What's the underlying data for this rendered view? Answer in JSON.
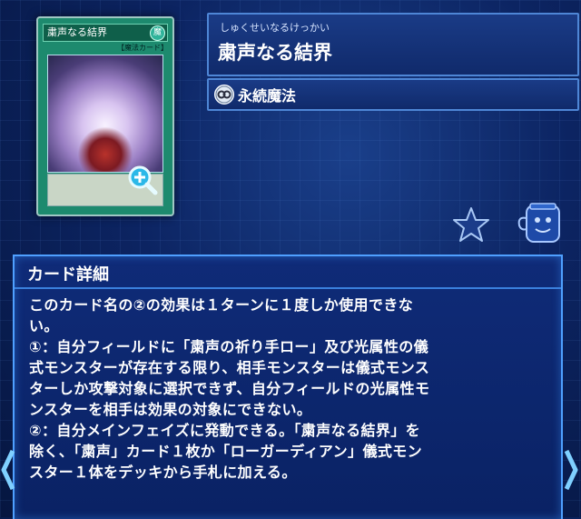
{
  "card": {
    "name": "粛声なる結界",
    "kana": "しゅくせいなるけっかい",
    "type_label": "永続魔法",
    "small_name": "粛声なる結界",
    "small_type": "【魔法カード】"
  },
  "detail": {
    "heading": "カード詳細",
    "lines": [
      "このカード名の②の効果は１ターンに１度しか使用できな",
      "い。",
      "①：自分フィールドに「粛声の祈り手ロー」及び光属性の儀",
      "式モンスターが存在する限り、相手モンスターは儀式モンス",
      "ターしか攻撃対象に選択できず、自分フィールドの光属性モ",
      "ンスターを相手は効果の対象にできない。",
      "②：自分メインフェイズに発動できる。「粛声なる結界」を",
      "除く、「粛声」カード１枚か「ローガーディアン」儀式モン",
      "スター１体をデッキから手札に加える。"
    ]
  },
  "icons": {
    "zoom": "zoom-in-icon",
    "favorite": "star-icon",
    "deck": "deck-jar-icon",
    "type": "continuous-spell-icon",
    "left": "chevron-left-icon",
    "right": "chevron-right-icon"
  },
  "colors": {
    "accent": "#4fa0ff",
    "panel": "#0f2b78",
    "card_green": "#1d8a6e"
  }
}
